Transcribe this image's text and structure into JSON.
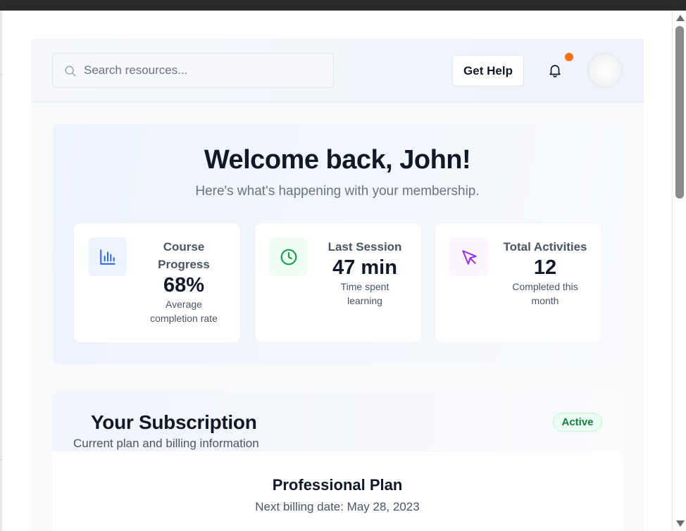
{
  "search": {
    "placeholder": "Search resources..."
  },
  "header": {
    "help_label": "Get Help"
  },
  "welcome": {
    "title": "Welcome back, John!",
    "subtitle": "Here's what's happening with your membership."
  },
  "stats": [
    {
      "label": "Course Progress",
      "value": "68%",
      "desc": "Average completion rate",
      "icon": "bar-chart-icon",
      "icon_color": "#2563eb",
      "icon_bg": "#eef4fd"
    },
    {
      "label": "Last Session",
      "value": "47 min",
      "desc": "Time spent learning",
      "icon": "clock-icon",
      "icon_color": "#16a34a",
      "icon_bg": "#f0fdf4"
    },
    {
      "label": "Total Activities",
      "value": "12",
      "desc": "Completed this month",
      "icon": "cursor-pointer-icon",
      "icon_color": "#9333ea",
      "icon_bg": "#faf5ff"
    }
  ],
  "subscription": {
    "title": "Your Subscription",
    "subtitle": "Current plan and billing information",
    "status": "Active",
    "plan_name": "Professional Plan",
    "billing": "Next billing date: May 28, 2023"
  },
  "colors": {
    "notification_dot": "#f97316",
    "badge_green": "#15803d"
  }
}
